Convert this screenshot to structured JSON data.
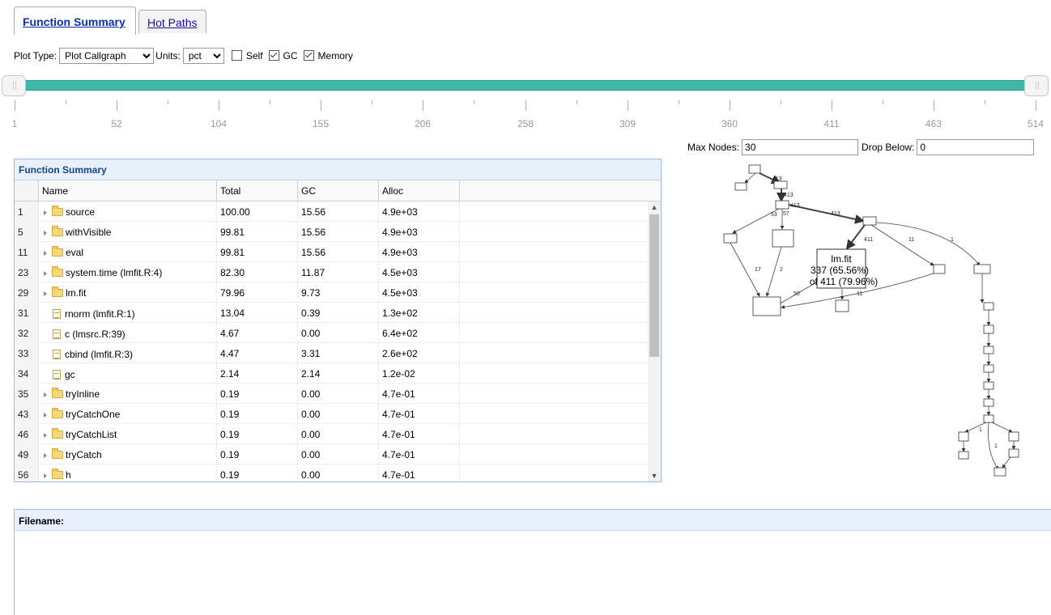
{
  "tabs": [
    {
      "label": "Function Summary",
      "active": true
    },
    {
      "label": "Hot Paths",
      "active": false
    }
  ],
  "controls": {
    "plot_type_label": "Plot Type:",
    "plot_type_value": "Plot Callgraph",
    "units_label": "Units:",
    "units_value": "pct",
    "self_label": "Self",
    "self_checked": false,
    "gc_label": "GC",
    "gc_checked": true,
    "memory_label": "Memory",
    "memory_checked": true
  },
  "slider": {
    "min": 1,
    "max": 514,
    "low": 1,
    "high": 514,
    "tick_labels": [
      "1",
      "52",
      "104",
      "155",
      "206",
      "258",
      "309",
      "360",
      "411",
      "463",
      "514"
    ],
    "color": "#3fb8a9"
  },
  "graph_options": {
    "max_nodes_label": "Max Nodes:",
    "max_nodes_value": "30",
    "drop_below_label": "Drop Below:",
    "drop_below_value": "0"
  },
  "grid": {
    "title": "Function Summary",
    "columns": [
      "Name",
      "Total",
      "GC",
      "Alloc"
    ],
    "rows": [
      {
        "id": "1",
        "name": "source",
        "type": "folder",
        "total": "100.00",
        "gc": "15.56",
        "alloc": "4.9e+03"
      },
      {
        "id": "5",
        "name": "withVisible",
        "type": "folder",
        "total": "99.81",
        "gc": "15.56",
        "alloc": "4.9e+03"
      },
      {
        "id": "11",
        "name": "eval",
        "type": "folder",
        "total": "99.81",
        "gc": "15.56",
        "alloc": "4.9e+03"
      },
      {
        "id": "23",
        "name": "system.time (lmfit.R:4)",
        "type": "folder",
        "total": "82.30",
        "gc": "11.87",
        "alloc": "4.5e+03"
      },
      {
        "id": "29",
        "name": "lm.fit",
        "type": "folder",
        "total": "79.96",
        "gc": "9.73",
        "alloc": "4.5e+03"
      },
      {
        "id": "31",
        "name": "rnorm (lmfit.R:1)",
        "type": "file",
        "total": "13.04",
        "gc": "0.39",
        "alloc": "1.3e+02"
      },
      {
        "id": "32",
        "name": "c (lmsrc.R:39)",
        "type": "file",
        "total": "4.67",
        "gc": "0.00",
        "alloc": "6.4e+02"
      },
      {
        "id": "33",
        "name": "cbind (lmfit.R:3)",
        "type": "file",
        "total": "4.47",
        "gc": "3.31",
        "alloc": "2.6e+02"
      },
      {
        "id": "34",
        "name": "gc",
        "type": "file",
        "total": "2.14",
        "gc": "2.14",
        "alloc": "1.2e-02"
      },
      {
        "id": "35",
        "name": "tryInline",
        "type": "folder",
        "total": "0.19",
        "gc": "0.00",
        "alloc": "4.7e-01"
      },
      {
        "id": "43",
        "name": "tryCatchOne",
        "type": "folder",
        "total": "0.19",
        "gc": "0.00",
        "alloc": "4.7e-01"
      },
      {
        "id": "46",
        "name": "tryCatchList",
        "type": "folder",
        "total": "0.19",
        "gc": "0.00",
        "alloc": "4.7e-01"
      },
      {
        "id": "49",
        "name": "tryCatch",
        "type": "folder",
        "total": "0.19",
        "gc": "0.00",
        "alloc": "4.7e-01"
      },
      {
        "id": "56",
        "name": "h",
        "type": "folder",
        "total": "0.19",
        "gc": "0.00",
        "alloc": "4.7e-01"
      }
    ]
  },
  "callgraph": {
    "highlight_node": {
      "title": "lm.fit",
      "line1": "337 (65.56%)",
      "line2": "of 411 (79.96%)"
    },
    "edge_labels": [
      "413",
      "413",
      "413",
      "57",
      "53",
      "413",
      "411",
      "11",
      "1",
      "17",
      "2",
      "50",
      "11",
      "1",
      "1"
    ]
  },
  "file_panel": {
    "title": "Filename:"
  }
}
